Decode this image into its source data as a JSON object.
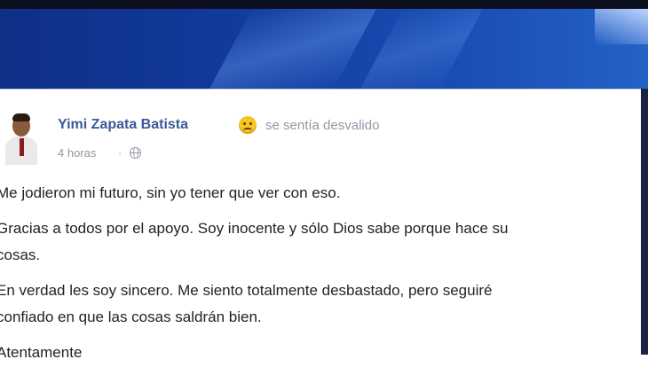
{
  "post": {
    "author": "Yimi Zapata Batista",
    "feeling_icon": "sad-face-emoji",
    "feeling": "se sentía desvalido",
    "time": "4 horas",
    "separator": "·",
    "privacy_icon": "globe-icon",
    "paragraphs": [
      "Me jodieron mi futuro, sin yo tener que ver con eso.",
      "Gracias a todos por el apoyo. Soy inocente y sólo Dios sabe porque hace su\ncosas.",
      "En verdad les soy sincero. Me siento totalmente desbastado, pero seguiré\nconfiado en que las cosas saldrán bien.",
      "Atentamente"
    ]
  },
  "colors": {
    "author": "#3b5998",
    "meta": "#9197a3",
    "cover": "#1a4db4"
  }
}
